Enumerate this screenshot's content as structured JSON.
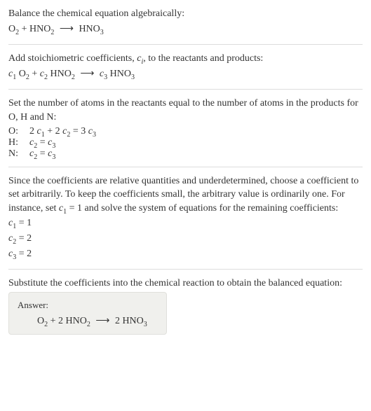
{
  "s1": {
    "l1": "Balance the chemical equation algebraically:"
  },
  "s2": {
    "l1_a": "Add stoichiometric coefficients, ",
    "l1_c": "c",
    "l1_i": "i",
    "l1_b": ", to the reactants and products:"
  },
  "s3": {
    "l1": "Set the number of atoms in the reactants equal to the number of atoms in the products for O, H and N:",
    "rows": [
      {
        "label": "O:"
      },
      {
        "label": "H:"
      },
      {
        "label": "N:"
      }
    ]
  },
  "s4": {
    "l1_a": "Since the coefficients are relative quantities and underdetermined, choose a coefficient to set arbitrarily. To keep the coefficients small, the arbitrary value is ordinarily one. For instance, set ",
    "l1_c": "c",
    "l1_1": "1",
    "l1_b": " = 1 and solve the system of equations for the remaining coefficients:"
  },
  "s5": {
    "l1": "Substitute the coefficients into the chemical reaction to obtain the balanced equation:"
  },
  "answer": {
    "label": "Answer:"
  },
  "chart_data": {
    "type": "table",
    "title": "Stoichiometric balancing of O2 + HNO2 → HNO3",
    "unbalanced_reactants": [
      "O2",
      "HNO2"
    ],
    "unbalanced_products": [
      "HNO3"
    ],
    "atom_balance_equations": [
      {
        "element": "O",
        "equation": "2 c1 + 2 c2 = 3 c3"
      },
      {
        "element": "H",
        "equation": "c2 = c3"
      },
      {
        "element": "N",
        "equation": "c2 = c3"
      }
    ],
    "solved_coefficients": {
      "c1": 1,
      "c2": 2,
      "c3": 2
    },
    "balanced_equation": "O2 + 2 HNO2 → 2 HNO3"
  }
}
